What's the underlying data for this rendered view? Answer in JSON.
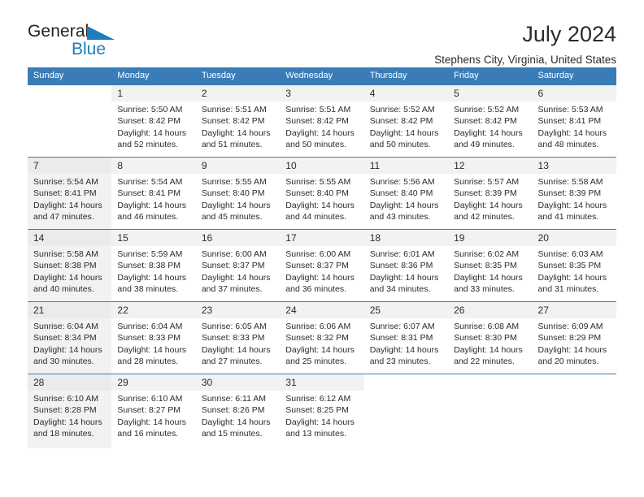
{
  "brand": {
    "name_part1": "General",
    "name_part2": "Blue",
    "logo_icon": "triangle-icon",
    "accent_color": "#1f7cc1"
  },
  "header": {
    "title": "July 2024",
    "subtitle": "Stephens City, Virginia, United States"
  },
  "calendar": {
    "header_bg": "#3a7cb8",
    "weekdays": [
      "Sunday",
      "Monday",
      "Tuesday",
      "Wednesday",
      "Thursday",
      "Friday",
      "Saturday"
    ],
    "weeks": [
      [
        {
          "day": "",
          "sunrise": "",
          "sunset": "",
          "daylight1": "",
          "daylight2": ""
        },
        {
          "day": "1",
          "sunrise": "Sunrise: 5:50 AM",
          "sunset": "Sunset: 8:42 PM",
          "daylight1": "Daylight: 14 hours",
          "daylight2": "and 52 minutes."
        },
        {
          "day": "2",
          "sunrise": "Sunrise: 5:51 AM",
          "sunset": "Sunset: 8:42 PM",
          "daylight1": "Daylight: 14 hours",
          "daylight2": "and 51 minutes."
        },
        {
          "day": "3",
          "sunrise": "Sunrise: 5:51 AM",
          "sunset": "Sunset: 8:42 PM",
          "daylight1": "Daylight: 14 hours",
          "daylight2": "and 50 minutes."
        },
        {
          "day": "4",
          "sunrise": "Sunrise: 5:52 AM",
          "sunset": "Sunset: 8:42 PM",
          "daylight1": "Daylight: 14 hours",
          "daylight2": "and 50 minutes."
        },
        {
          "day": "5",
          "sunrise": "Sunrise: 5:52 AM",
          "sunset": "Sunset: 8:42 PM",
          "daylight1": "Daylight: 14 hours",
          "daylight2": "and 49 minutes."
        },
        {
          "day": "6",
          "sunrise": "Sunrise: 5:53 AM",
          "sunset": "Sunset: 8:41 PM",
          "daylight1": "Daylight: 14 hours",
          "daylight2": "and 48 minutes."
        }
      ],
      [
        {
          "day": "7",
          "sunrise": "Sunrise: 5:54 AM",
          "sunset": "Sunset: 8:41 PM",
          "daylight1": "Daylight: 14 hours",
          "daylight2": "and 47 minutes."
        },
        {
          "day": "8",
          "sunrise": "Sunrise: 5:54 AM",
          "sunset": "Sunset: 8:41 PM",
          "daylight1": "Daylight: 14 hours",
          "daylight2": "and 46 minutes."
        },
        {
          "day": "9",
          "sunrise": "Sunrise: 5:55 AM",
          "sunset": "Sunset: 8:40 PM",
          "daylight1": "Daylight: 14 hours",
          "daylight2": "and 45 minutes."
        },
        {
          "day": "10",
          "sunrise": "Sunrise: 5:55 AM",
          "sunset": "Sunset: 8:40 PM",
          "daylight1": "Daylight: 14 hours",
          "daylight2": "and 44 minutes."
        },
        {
          "day": "11",
          "sunrise": "Sunrise: 5:56 AM",
          "sunset": "Sunset: 8:40 PM",
          "daylight1": "Daylight: 14 hours",
          "daylight2": "and 43 minutes."
        },
        {
          "day": "12",
          "sunrise": "Sunrise: 5:57 AM",
          "sunset": "Sunset: 8:39 PM",
          "daylight1": "Daylight: 14 hours",
          "daylight2": "and 42 minutes."
        },
        {
          "day": "13",
          "sunrise": "Sunrise: 5:58 AM",
          "sunset": "Sunset: 8:39 PM",
          "daylight1": "Daylight: 14 hours",
          "daylight2": "and 41 minutes."
        }
      ],
      [
        {
          "day": "14",
          "sunrise": "Sunrise: 5:58 AM",
          "sunset": "Sunset: 8:38 PM",
          "daylight1": "Daylight: 14 hours",
          "daylight2": "and 40 minutes."
        },
        {
          "day": "15",
          "sunrise": "Sunrise: 5:59 AM",
          "sunset": "Sunset: 8:38 PM",
          "daylight1": "Daylight: 14 hours",
          "daylight2": "and 38 minutes."
        },
        {
          "day": "16",
          "sunrise": "Sunrise: 6:00 AM",
          "sunset": "Sunset: 8:37 PM",
          "daylight1": "Daylight: 14 hours",
          "daylight2": "and 37 minutes."
        },
        {
          "day": "17",
          "sunrise": "Sunrise: 6:00 AM",
          "sunset": "Sunset: 8:37 PM",
          "daylight1": "Daylight: 14 hours",
          "daylight2": "and 36 minutes."
        },
        {
          "day": "18",
          "sunrise": "Sunrise: 6:01 AM",
          "sunset": "Sunset: 8:36 PM",
          "daylight1": "Daylight: 14 hours",
          "daylight2": "and 34 minutes."
        },
        {
          "day": "19",
          "sunrise": "Sunrise: 6:02 AM",
          "sunset": "Sunset: 8:35 PM",
          "daylight1": "Daylight: 14 hours",
          "daylight2": "and 33 minutes."
        },
        {
          "day": "20",
          "sunrise": "Sunrise: 6:03 AM",
          "sunset": "Sunset: 8:35 PM",
          "daylight1": "Daylight: 14 hours",
          "daylight2": "and 31 minutes."
        }
      ],
      [
        {
          "day": "21",
          "sunrise": "Sunrise: 6:04 AM",
          "sunset": "Sunset: 8:34 PM",
          "daylight1": "Daylight: 14 hours",
          "daylight2": "and 30 minutes."
        },
        {
          "day": "22",
          "sunrise": "Sunrise: 6:04 AM",
          "sunset": "Sunset: 8:33 PM",
          "daylight1": "Daylight: 14 hours",
          "daylight2": "and 28 minutes."
        },
        {
          "day": "23",
          "sunrise": "Sunrise: 6:05 AM",
          "sunset": "Sunset: 8:33 PM",
          "daylight1": "Daylight: 14 hours",
          "daylight2": "and 27 minutes."
        },
        {
          "day": "24",
          "sunrise": "Sunrise: 6:06 AM",
          "sunset": "Sunset: 8:32 PM",
          "daylight1": "Daylight: 14 hours",
          "daylight2": "and 25 minutes."
        },
        {
          "day": "25",
          "sunrise": "Sunrise: 6:07 AM",
          "sunset": "Sunset: 8:31 PM",
          "daylight1": "Daylight: 14 hours",
          "daylight2": "and 23 minutes."
        },
        {
          "day": "26",
          "sunrise": "Sunrise: 6:08 AM",
          "sunset": "Sunset: 8:30 PM",
          "daylight1": "Daylight: 14 hours",
          "daylight2": "and 22 minutes."
        },
        {
          "day": "27",
          "sunrise": "Sunrise: 6:09 AM",
          "sunset": "Sunset: 8:29 PM",
          "daylight1": "Daylight: 14 hours",
          "daylight2": "and 20 minutes."
        }
      ],
      [
        {
          "day": "28",
          "sunrise": "Sunrise: 6:10 AM",
          "sunset": "Sunset: 8:28 PM",
          "daylight1": "Daylight: 14 hours",
          "daylight2": "and 18 minutes."
        },
        {
          "day": "29",
          "sunrise": "Sunrise: 6:10 AM",
          "sunset": "Sunset: 8:27 PM",
          "daylight1": "Daylight: 14 hours",
          "daylight2": "and 16 minutes."
        },
        {
          "day": "30",
          "sunrise": "Sunrise: 6:11 AM",
          "sunset": "Sunset: 8:26 PM",
          "daylight1": "Daylight: 14 hours",
          "daylight2": "and 15 minutes."
        },
        {
          "day": "31",
          "sunrise": "Sunrise: 6:12 AM",
          "sunset": "Sunset: 8:25 PM",
          "daylight1": "Daylight: 14 hours",
          "daylight2": "and 13 minutes."
        },
        {
          "day": "",
          "sunrise": "",
          "sunset": "",
          "daylight1": "",
          "daylight2": ""
        },
        {
          "day": "",
          "sunrise": "",
          "sunset": "",
          "daylight1": "",
          "daylight2": ""
        },
        {
          "day": "",
          "sunrise": "",
          "sunset": "",
          "daylight1": "",
          "daylight2": ""
        }
      ]
    ]
  }
}
